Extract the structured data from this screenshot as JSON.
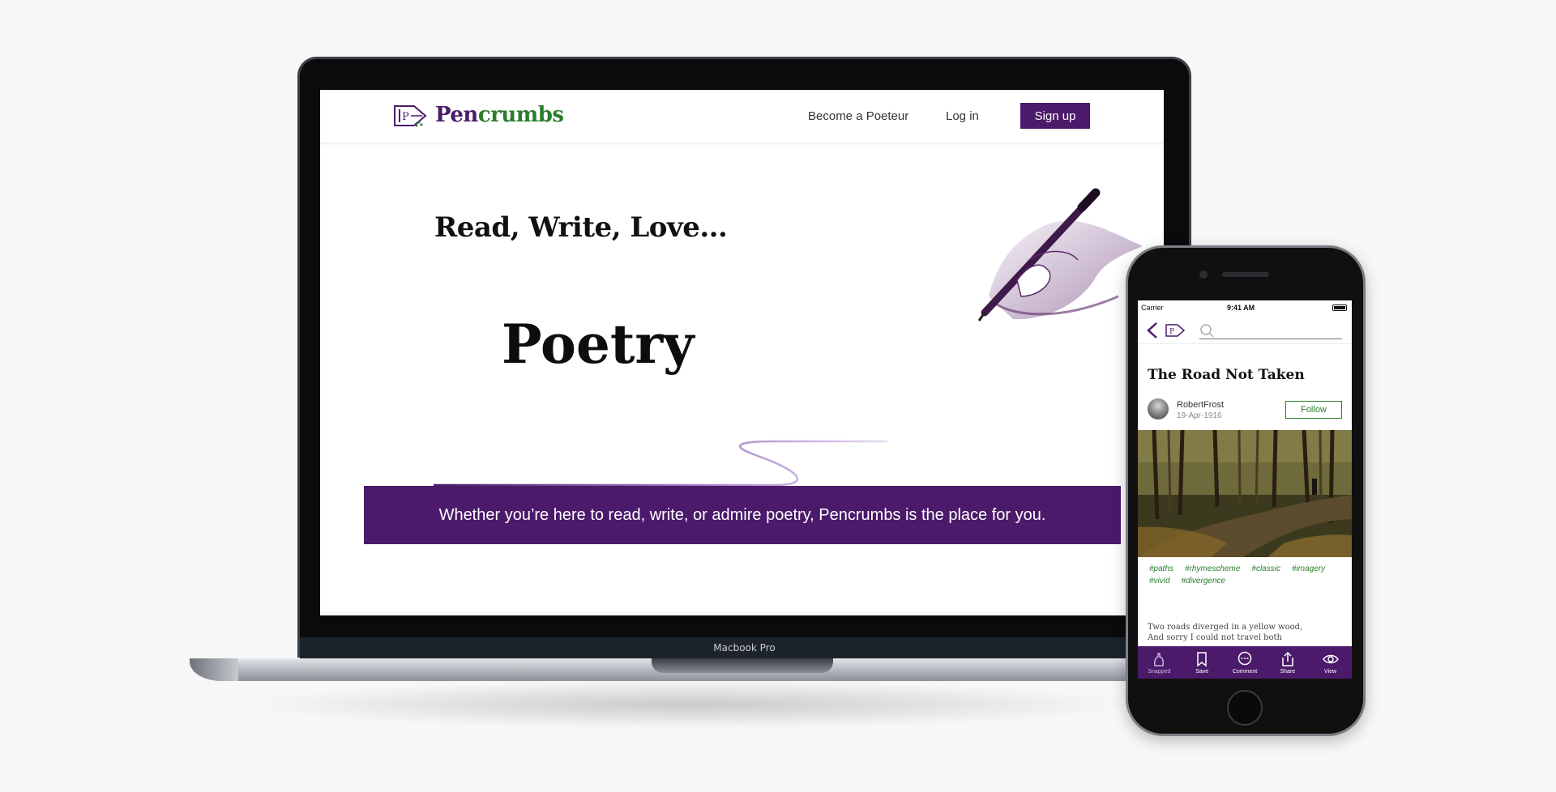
{
  "laptop": {
    "model_label": "Macbook Pro"
  },
  "website": {
    "logo": {
      "pen": "Pen",
      "crumbs": "crumbs"
    },
    "nav": {
      "become_poeteur": "Become a Poeteur",
      "login": "Log in",
      "signup": "Sign up"
    },
    "hero": {
      "tagline": "Read, Write, Love...",
      "word": "Poetry"
    },
    "banner": "Whether you’re here to read, write, or admire poetry, Pencrumbs is the place for you."
  },
  "phone": {
    "status": {
      "carrier": "Carrier",
      "time": "9:41 AM"
    },
    "poem": {
      "title": "The Road Not Taken",
      "author": "RobertFrost",
      "date": "19-Apr-1916",
      "follow_label": "Follow",
      "hashtags": [
        "#paths",
        "#rhymescheme",
        "#classic",
        "#imagery",
        "#vivid",
        "#divergence"
      ],
      "lines": [
        "Two roads diverged in a yellow wood,",
        "And sorry I could not travel both"
      ]
    },
    "tabs": [
      "Snapped",
      "Save",
      "Comment",
      "Share",
      "View"
    ]
  },
  "colors": {
    "brand_purple": "#4b1a6b",
    "brand_green": "#2b7d2b"
  }
}
